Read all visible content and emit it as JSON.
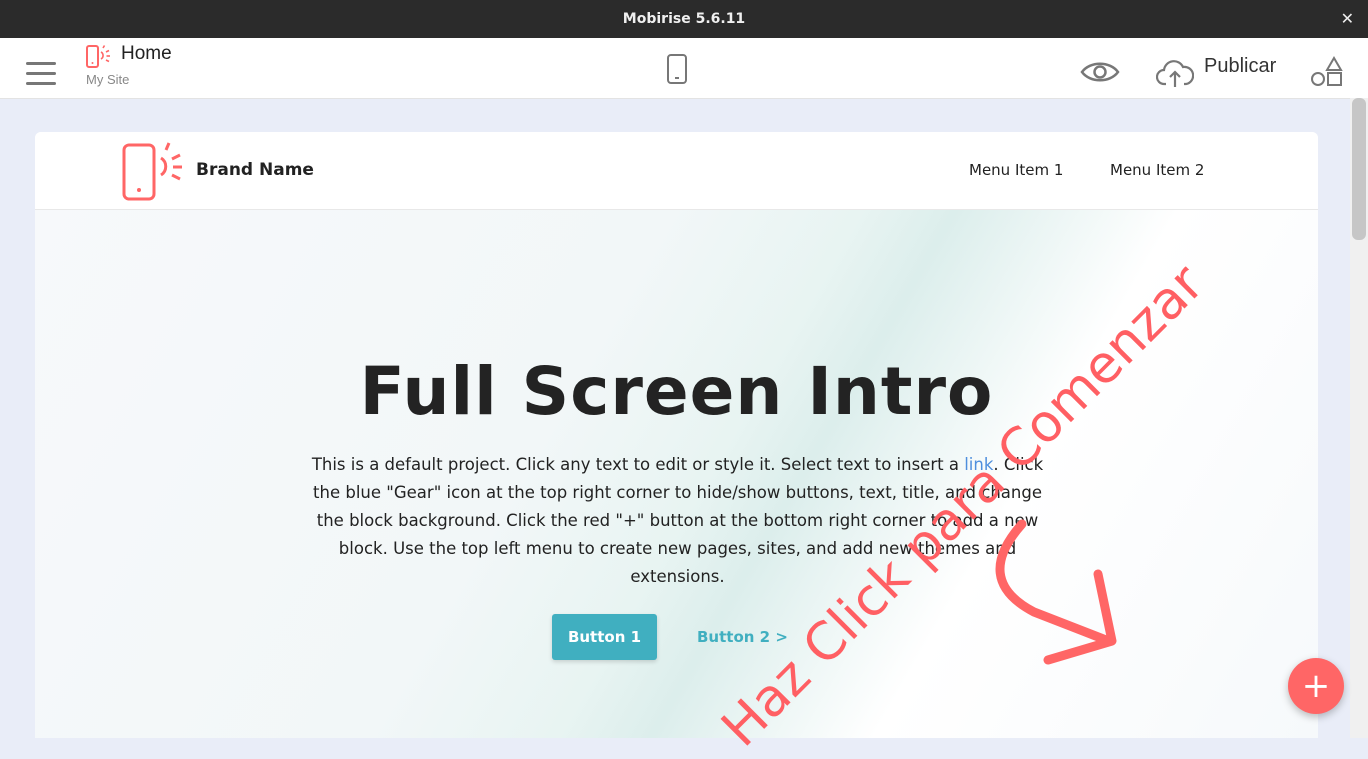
{
  "window": {
    "title": "Mobirise 5.6.11",
    "close_glyph": "✕"
  },
  "toolbar": {
    "page_name": "Home",
    "site_name": "My Site",
    "publish_label": "Publicar",
    "icons": [
      "hamburger-menu-icon",
      "page-icon",
      "mobile-view-icon",
      "eye-icon",
      "cloud-upload-icon",
      "shapes-icon"
    ]
  },
  "site": {
    "brand_name": "Brand Name",
    "menu": [
      "Menu Item 1",
      "Menu Item 2"
    ]
  },
  "hero": {
    "title": "Full Screen Intro",
    "text_before_link": "This is a default project. Click any text to edit or style it. Select text to insert a ",
    "link_text": "link",
    "text_after_link": ". Click the blue \"Gear\" icon at the top right corner to hide/show buttons, text, title, and change the block background. Click the red \"+\" button at the bottom right corner to add a new block. Use the top left menu to create new pages, sites, and add new themes and extensions.",
    "button1": "Button 1",
    "button2": "Button 2 >"
  },
  "overlay": {
    "text": "Haz Click para Comenzar"
  },
  "add_button": {
    "glyph": "+"
  },
  "colors": {
    "accent_red": "#ff6666",
    "button_teal": "#40afc0",
    "link_blue": "#4f8fdd",
    "titlebar": "#2b2b2b"
  }
}
